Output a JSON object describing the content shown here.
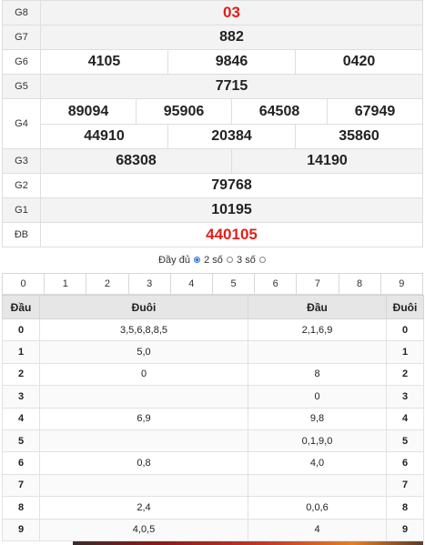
{
  "prizes": {
    "g8": {
      "label": "G8",
      "value": "03"
    },
    "g7": {
      "label": "G7",
      "value": "882"
    },
    "g6": {
      "label": "G6",
      "values": [
        "4105",
        "9846",
        "0420"
      ]
    },
    "g5": {
      "label": "G5",
      "value": "7715"
    },
    "g4": {
      "label": "G4",
      "row1": [
        "89094",
        "95906",
        "64508",
        "67949"
      ],
      "row2": [
        "44910",
        "20384",
        "35860"
      ]
    },
    "g3": {
      "label": "G3",
      "values": [
        "68308",
        "14190"
      ]
    },
    "g2": {
      "label": "G2",
      "value": "79768"
    },
    "g1": {
      "label": "G1",
      "value": "10195"
    },
    "db": {
      "label": "ĐB",
      "value": "440105"
    }
  },
  "display_options": {
    "full": "Đầy đủ",
    "two": "2 số",
    "three": "3 số",
    "selected": "two"
  },
  "digit_filter": [
    "0",
    "1",
    "2",
    "3",
    "4",
    "5",
    "6",
    "7",
    "8",
    "9"
  ],
  "loto_table": {
    "headers": [
      "Đầu",
      "Đuôi",
      "Đầu",
      "Đuôi"
    ],
    "rows": [
      {
        "dau": "0",
        "duoi": "3,5,6,8,8,5",
        "dau2": "2,1,6,9",
        "duoi2": "0"
      },
      {
        "dau": "1",
        "duoi": "5,0",
        "dau2": "",
        "duoi2": "1"
      },
      {
        "dau": "2",
        "duoi": "0",
        "dau2": "8",
        "duoi2": "2"
      },
      {
        "dau": "3",
        "duoi": "",
        "dau2": "0",
        "duoi2": "3"
      },
      {
        "dau": "4",
        "duoi": "6,9",
        "dau2": "9,8",
        "duoi2": "4"
      },
      {
        "dau": "5",
        "duoi": "",
        "dau2": "0,1,9,0",
        "duoi2": "5"
      },
      {
        "dau": "6",
        "duoi": "0,8",
        "dau2": "4,0",
        "duoi2": "6"
      },
      {
        "dau": "7",
        "duoi": "",
        "dau2": "",
        "duoi2": "7"
      },
      {
        "dau": "8",
        "duoi": "2,4",
        "dau2": "0,0,6",
        "duoi2": "8"
      },
      {
        "dau": "9",
        "duoi": "4,0,5",
        "dau2": "4",
        "duoi2": "9"
      }
    ]
  },
  "colors": {
    "accent_red": "#e0201b",
    "radio_blue": "#2a72d4",
    "header_gray": "#e6e6e6"
  }
}
